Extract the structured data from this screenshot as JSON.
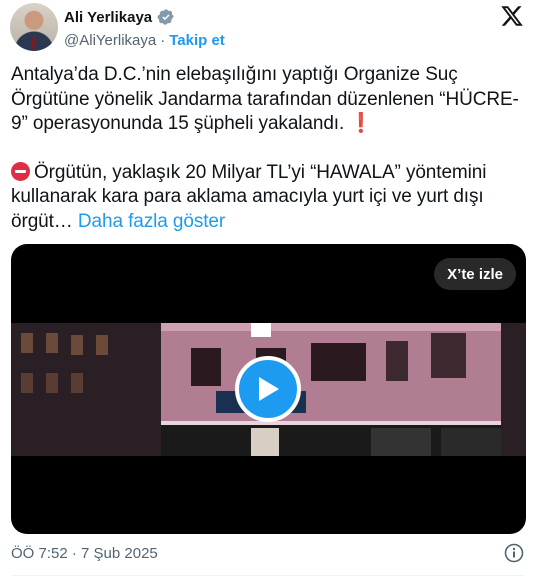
{
  "author": {
    "display_name": "Ali Yerlikaya",
    "handle": "@AliYerlikaya",
    "separator": "·",
    "follow_label": "Takip et",
    "verified_color": "#829aab",
    "avatar_icon": "avatar-photo"
  },
  "brand": {
    "logo_icon": "x-logo-icon"
  },
  "tweet": {
    "paragraph1": "Antalya’da D.C.’nin elebaşılığını yaptığı Organize Suç Örgütüne yönelik Jandarma tarafından düzenlenen “HÜCRE-9” operasyonunda 15 şüpheli yakalandı.",
    "paragraph1_emoji": "❗",
    "paragraph2": "Örgütün, yaklaşık 20 Milyar TL’yi “HAWALA” yöntemini kullanarak kara para aklama amacıyla yurt içi ve yurt dışı örgüt…",
    "paragraph2_emoji": "no-entry-icon",
    "show_more_label": "Daha fazla göster"
  },
  "media": {
    "watch_label": "X’te izle",
    "play_icon": "play-icon",
    "play_color": "#1d9bf0"
  },
  "footer": {
    "timestamp": "ÖÖ 7:52 · 7 Şub 2025",
    "info_icon": "info-icon"
  },
  "colors": {
    "link": "#1d9bf0",
    "muted": "#536471",
    "text": "#0f1419"
  }
}
